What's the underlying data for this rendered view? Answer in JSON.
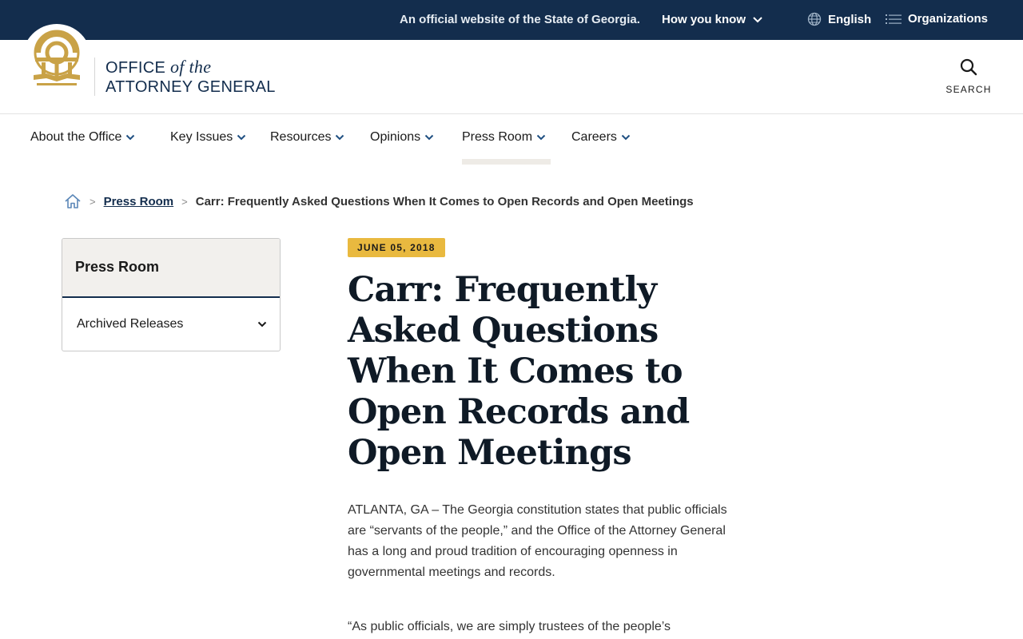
{
  "banner": {
    "official_text": "An official website of the State of Georgia.",
    "how_you_know": "How you know",
    "language": "English",
    "organizations": "Organizations"
  },
  "header": {
    "title_line1_a": "OFFICE",
    "title_line1_b": "of the",
    "title_line2": "ATTORNEY GENERAL",
    "search_label": "SEARCH"
  },
  "nav": {
    "items": [
      {
        "label": "About the Office"
      },
      {
        "label": "Key Issues"
      },
      {
        "label": "Resources"
      },
      {
        "label": "Opinions"
      },
      {
        "label": "Press Room"
      },
      {
        "label": "Careers"
      }
    ],
    "active": "Press Room"
  },
  "breadcrumb": {
    "parent": "Press Room",
    "current": "Carr: Frequently Asked Questions When It Comes to Open Records and Open Meetings"
  },
  "sidebar": {
    "heading": "Press Room",
    "items": [
      {
        "label": "Archived Releases"
      }
    ]
  },
  "article": {
    "date": "JUNE 05, 2018",
    "title": "Carr: Frequently Asked Questions When It Comes to Open Records and Open Meetings",
    "paragraph1": "ATLANTA, GA – The Georgia constitution states that public officials are “servants of the people,” and the Office of the Attorney General has a long and proud tradition of encouraging openness in governmental meetings and records.",
    "paragraph2": "“As public officials, we are simply trustees of the people’s"
  },
  "colors": {
    "navy": "#132d4d",
    "gold": "#e9b93f",
    "seal_gold": "#c9a247"
  }
}
